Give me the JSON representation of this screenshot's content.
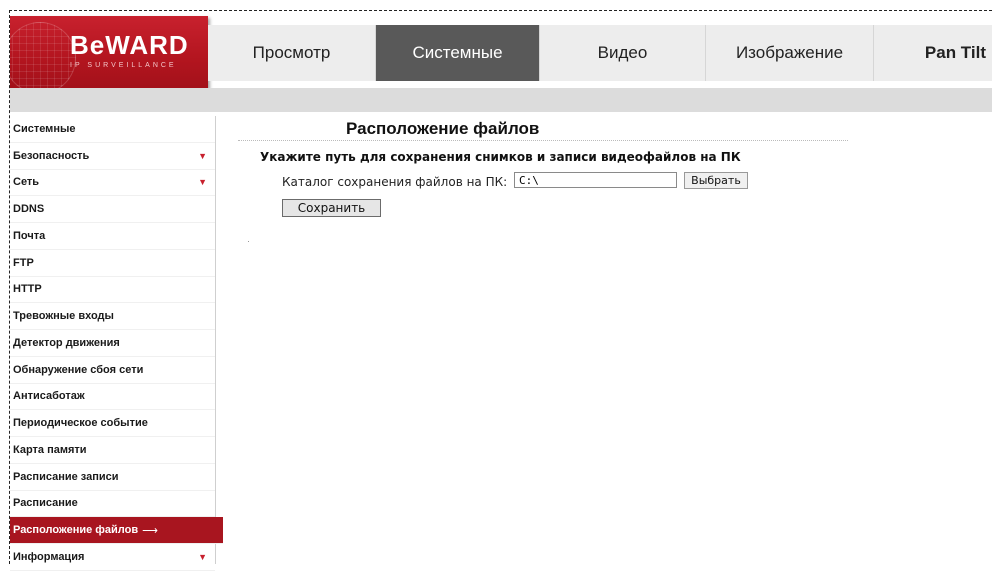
{
  "brand": {
    "name": "BeWARD",
    "tagline": "IP SURVEILLANCE"
  },
  "colors": {
    "brand_red": "#b3151f",
    "active_tab": "#595959",
    "active_side": "#a8151f"
  },
  "topnav": {
    "tabs": [
      {
        "label": "Просмотр",
        "active": false
      },
      {
        "label": "Системные",
        "active": true
      },
      {
        "label": "Видео",
        "active": false
      },
      {
        "label": "Изображение",
        "active": false
      },
      {
        "label": "Pan Tilt",
        "active": false
      }
    ]
  },
  "sidebar": {
    "items": [
      {
        "label": "Системные",
        "arrow": false
      },
      {
        "label": "Безопасность",
        "arrow": true
      },
      {
        "label": "Сеть",
        "arrow": true
      },
      {
        "label": "DDNS",
        "arrow": false
      },
      {
        "label": "Почта",
        "arrow": false
      },
      {
        "label": "FTP",
        "arrow": false
      },
      {
        "label": "HTTP",
        "arrow": false
      },
      {
        "label": "Тревожные входы",
        "arrow": false
      },
      {
        "label": "Детектор движения",
        "arrow": false
      },
      {
        "label": "Обнаружение сбоя сети",
        "arrow": false
      },
      {
        "label": "Антисаботаж",
        "arrow": false
      },
      {
        "label": "Периодическое событие",
        "arrow": false
      },
      {
        "label": "Карта памяти",
        "arrow": false
      },
      {
        "label": "Расписание записи",
        "arrow": false
      },
      {
        "label": "Расписание",
        "arrow": false
      },
      {
        "label": "Расположение файлов",
        "arrow": false,
        "active": true
      },
      {
        "label": "Информация",
        "arrow": true
      }
    ],
    "arrow_glyph": "▼",
    "pointer_glyph": "⟶"
  },
  "main": {
    "title": "Расположение файлов",
    "subtitle": "Укажите путь для сохранения снимков и записи видеофайлов на ПК",
    "field_label": "Каталог сохранения файлов на ПК:",
    "path_value": "C:\\",
    "choose_button": "Выбрать",
    "save_button": "Сохранить"
  }
}
